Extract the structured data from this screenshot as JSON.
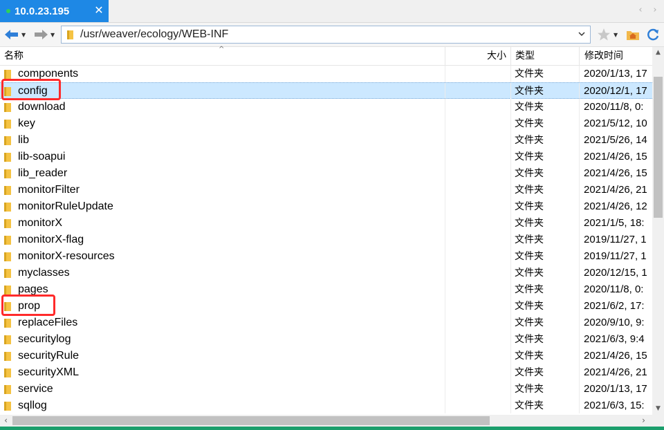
{
  "tab": {
    "title": "10.0.23.195",
    "close": "✕"
  },
  "tabnav": {
    "prev": "‹",
    "next": "›"
  },
  "address": {
    "path": "/usr/weaver/ecology/WEB-INF"
  },
  "columns": {
    "name": "名称",
    "size": "大小",
    "type": "类型",
    "modified": "修改时间"
  },
  "files": [
    {
      "name": "components",
      "type": "文件夹",
      "modified": "2020/1/13, 17"
    },
    {
      "name": "config",
      "type": "文件夹",
      "modified": "2020/12/1, 17"
    },
    {
      "name": "download",
      "type": "文件夹",
      "modified": "2020/11/8, 0:"
    },
    {
      "name": "key",
      "type": "文件夹",
      "modified": "2021/5/12, 10"
    },
    {
      "name": "lib",
      "type": "文件夹",
      "modified": "2021/5/26, 14"
    },
    {
      "name": "lib-soapui",
      "type": "文件夹",
      "modified": "2021/4/26, 15"
    },
    {
      "name": "lib_reader",
      "type": "文件夹",
      "modified": "2021/4/26, 15"
    },
    {
      "name": "monitorFilter",
      "type": "文件夹",
      "modified": "2021/4/26, 21"
    },
    {
      "name": "monitorRuleUpdate",
      "type": "文件夹",
      "modified": "2021/4/26, 12"
    },
    {
      "name": "monitorX",
      "type": "文件夹",
      "modified": "2021/1/5, 18:"
    },
    {
      "name": "monitorX-flag",
      "type": "文件夹",
      "modified": "2019/11/27, 1"
    },
    {
      "name": "monitorX-resources",
      "type": "文件夹",
      "modified": "2019/11/27, 1"
    },
    {
      "name": "myclasses",
      "type": "文件夹",
      "modified": "2020/12/15, 1"
    },
    {
      "name": "pages",
      "type": "文件夹",
      "modified": "2020/11/8, 0:"
    },
    {
      "name": "prop",
      "type": "文件夹",
      "modified": "2021/6/2, 17:"
    },
    {
      "name": "replaceFiles",
      "type": "文件夹",
      "modified": "2020/9/10, 9:"
    },
    {
      "name": "securitylog",
      "type": "文件夹",
      "modified": "2021/6/3, 9:4"
    },
    {
      "name": "securityRule",
      "type": "文件夹",
      "modified": "2021/4/26, 15"
    },
    {
      "name": "securityXML",
      "type": "文件夹",
      "modified": "2021/4/26, 21"
    },
    {
      "name": "service",
      "type": "文件夹",
      "modified": "2020/1/13, 17"
    },
    {
      "name": "sqllog",
      "type": "文件夹",
      "modified": "2021/6/3, 15:"
    }
  ],
  "selected_index": 1,
  "highlighted_indices": [
    1,
    14
  ],
  "colors": {
    "tab_active": "#1e88e5",
    "selection": "#cce8ff",
    "highlight_box": "#ff2a2a",
    "folder": "#f5c343",
    "status_strip": "#1b9e6c"
  },
  "icons": {
    "back": "arrow-left-icon",
    "forward": "arrow-right-icon",
    "folder": "folder-icon",
    "bookmark": "star-icon",
    "home": "home-folder-icon",
    "refresh": "refresh-icon"
  }
}
